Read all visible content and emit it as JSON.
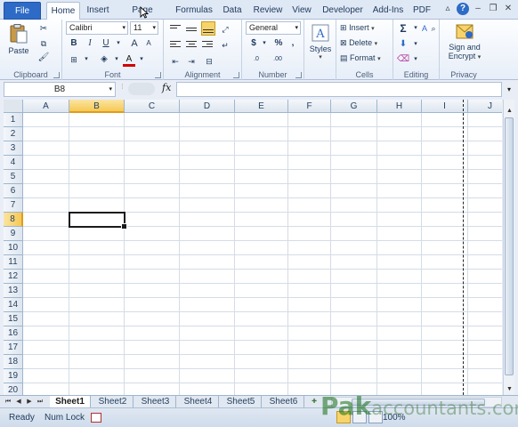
{
  "tabs": {
    "file": "File",
    "items": [
      "Home",
      "Insert",
      "Page Layout",
      "Formulas",
      "Data",
      "Review",
      "View",
      "Developer",
      "Add-Ins",
      "PDF"
    ]
  },
  "ribbon": {
    "clipboard": {
      "paste": "Paste",
      "label": "Clipboard"
    },
    "font": {
      "name": "Calibri",
      "size": "11",
      "bold": "B",
      "italic": "I",
      "underline": "U",
      "grow": "A",
      "shrink": "A",
      "color_letter": "A",
      "label": "Font"
    },
    "alignment": {
      "label": "Alignment"
    },
    "number": {
      "format": "General",
      "currency": "$",
      "percent": "%",
      "comma": ",",
      "inc_decimal": ".0",
      "dec_decimal": ".00",
      "label": "Number"
    },
    "styles": {
      "label": "Styles"
    },
    "cells": {
      "insert": "Insert",
      "delete": "Delete",
      "format": "Format",
      "label": "Cells"
    },
    "editing": {
      "sum": "Σ",
      "sort": "A",
      "label": "Editing"
    },
    "privacy": {
      "sign": "Sign and",
      "encrypt": "Encrypt",
      "label": "Privacy"
    }
  },
  "formula_bar": {
    "name_box": "B8",
    "fx": "fx",
    "value": ""
  },
  "grid": {
    "columns": [
      "A",
      "B",
      "C",
      "D",
      "E",
      "F",
      "G",
      "H",
      "I",
      "J"
    ],
    "rows": [
      "1",
      "2",
      "3",
      "4",
      "5",
      "6",
      "7",
      "8",
      "9",
      "10",
      "11",
      "12",
      "13",
      "14",
      "15",
      "16",
      "17",
      "18",
      "19",
      "20"
    ],
    "selected_column": "B",
    "selected_row": "8"
  },
  "sheets": [
    "Sheet1",
    "Sheet2",
    "Sheet3",
    "Sheet4",
    "Sheet5",
    "Sheet6"
  ],
  "active_sheet": "Sheet1",
  "status": {
    "ready": "Ready",
    "numlock": "Num Lock",
    "zoom": "100%"
  },
  "watermark": {
    "brand": "Pak",
    "site": "accountants.com"
  },
  "colors": {
    "file_tab": "#2e6bc6",
    "selected_header": "#f5c953",
    "gridline": "#d4dce6"
  }
}
